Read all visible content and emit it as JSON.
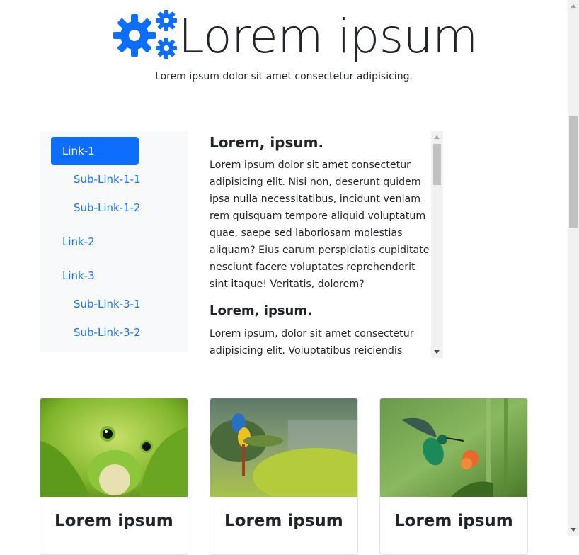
{
  "header": {
    "title": "Lorem ipsum",
    "subtitle": "Lorem ipsum dolor sit amet consectetur adipisicing.",
    "logo_icon": "gears-icon",
    "accent_color": "#0d6efd"
  },
  "nav": {
    "items": [
      {
        "label": "Link-1",
        "active": true
      },
      {
        "label": "Sub-Link-1-1"
      },
      {
        "label": "Sub-Link-1-2"
      },
      {
        "label": "Link-2"
      },
      {
        "label": "Link-3"
      },
      {
        "label": "Sub-Link-3-1"
      },
      {
        "label": "Sub-Link-3-2"
      }
    ]
  },
  "content": {
    "sections": [
      {
        "heading": "Lorem, ipsum.",
        "body": "Lorem ipsum dolor sit amet consectetur adipisicing elit. Nisi non, deserunt quidem ipsa nulla necessitatibus, incidunt veniam rem quisquam tempore aliquid voluptatum quae, saepe sed laboriosam molestias aliquam? Eius earum perspiciatis cupiditate nesciunt facere voluptates reprehenderit sint itaque! Veritatis, dolorem?"
      },
      {
        "heading": "Lorem, ipsum.",
        "body": "Lorem ipsum, dolor sit amet consectetur adipisicing elit. Voluptatibus reiciendis porro"
      }
    ]
  },
  "cards": [
    {
      "title": "Lorem ipsum",
      "image": "frog"
    },
    {
      "title": "Lorem ipsum",
      "image": "macaw"
    },
    {
      "title": "Lorem ipsum",
      "image": "hummingbird"
    }
  ]
}
